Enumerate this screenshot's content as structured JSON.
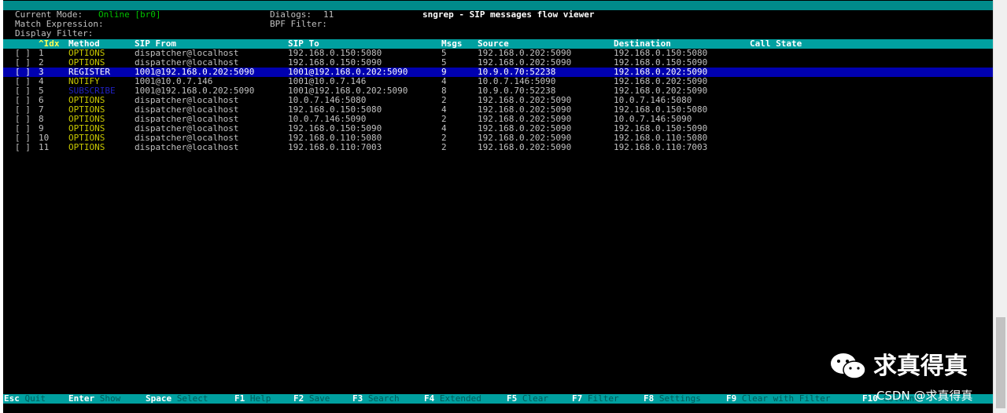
{
  "title": "sngrep - SIP messages flow viewer",
  "info": {
    "current_mode_label": "Current Mode:",
    "current_mode_value": "Online [br0]",
    "dialogs_label": "Dialogs:",
    "dialogs_value": "11",
    "match_expression_label": "Match Expression:",
    "bpf_filter_label": "BPF Filter:",
    "display_filter_label": "Display Filter:"
  },
  "columns": {
    "idx": "^Idx",
    "method": "Method",
    "sip_from": "SIP From",
    "sip_to": "SIP To",
    "msgs": "Msgs",
    "source": "Source",
    "destination": "Destination",
    "call_state": "Call State"
  },
  "rows": [
    {
      "check": "[ ]",
      "idx": "1",
      "method": "OPTIONS",
      "from": "dispatcher@localhost",
      "to": "192.168.0.150:5080",
      "msgs": "5",
      "source": "192.168.0.202:5090",
      "destination": "192.168.0.150:5080",
      "state": ""
    },
    {
      "check": "[ ]",
      "idx": "2",
      "method": "OPTIONS",
      "from": "dispatcher@localhost",
      "to": "192.168.0.150:5090",
      "msgs": "5",
      "source": "192.168.0.202:5090",
      "destination": "192.168.0.150:5090",
      "state": ""
    },
    {
      "check": "[ ]",
      "idx": "3",
      "method": "REGISTER",
      "from": "1001@192.168.0.202:5090",
      "to": "1001@192.168.0.202:5090",
      "msgs": "9",
      "source": "10.9.0.70:52238",
      "destination": "192.168.0.202:5090",
      "state": ""
    },
    {
      "check": "[ ]",
      "idx": "4",
      "method": "NOTIFY",
      "from": "1001@10.0.7.146",
      "to": "1001@10.0.7.146",
      "msgs": "4",
      "source": "10.0.7.146:5090",
      "destination": "192.168.0.202:5090",
      "state": ""
    },
    {
      "check": "[ ]",
      "idx": "5",
      "method": "SUBSCRIBE",
      "from": "1001@192.168.0.202:5090",
      "to": "1001@192.168.0.202:5090",
      "msgs": "8",
      "source": "10.9.0.70:52238",
      "destination": "192.168.0.202:5090",
      "state": ""
    },
    {
      "check": "[ ]",
      "idx": "6",
      "method": "OPTIONS",
      "from": "dispatcher@localhost",
      "to": "10.0.7.146:5080",
      "msgs": "2",
      "source": "192.168.0.202:5090",
      "destination": "10.0.7.146:5080",
      "state": ""
    },
    {
      "check": "[ ]",
      "idx": "7",
      "method": "OPTIONS",
      "from": "dispatcher@localhost",
      "to": "192.168.0.150:5080",
      "msgs": "4",
      "source": "192.168.0.202:5090",
      "destination": "192.168.0.150:5080",
      "state": ""
    },
    {
      "check": "[ ]",
      "idx": "8",
      "method": "OPTIONS",
      "from": "dispatcher@localhost",
      "to": "10.0.7.146:5090",
      "msgs": "2",
      "source": "192.168.0.202:5090",
      "destination": "10.0.7.146:5090",
      "state": ""
    },
    {
      "check": "[ ]",
      "idx": "9",
      "method": "OPTIONS",
      "from": "dispatcher@localhost",
      "to": "192.168.0.150:5090",
      "msgs": "4",
      "source": "192.168.0.202:5090",
      "destination": "192.168.0.150:5090",
      "state": ""
    },
    {
      "check": "[ ]",
      "idx": "10",
      "method": "OPTIONS",
      "from": "dispatcher@localhost",
      "to": "192.168.0.110:5080",
      "msgs": "2",
      "source": "192.168.0.202:5090",
      "destination": "192.168.0.110:5080",
      "state": ""
    },
    {
      "check": "[ ]",
      "idx": "11",
      "method": "OPTIONS",
      "from": "dispatcher@localhost",
      "to": "192.168.0.110:7003",
      "msgs": "2",
      "source": "192.168.0.202:5090",
      "destination": "192.168.0.110:7003",
      "state": ""
    }
  ],
  "footer": [
    {
      "key": "Esc",
      "action": "Quit"
    },
    {
      "key": "Enter",
      "action": "Show"
    },
    {
      "key": "Space",
      "action": "Select"
    },
    {
      "key": "F1",
      "action": "Help"
    },
    {
      "key": "F2",
      "action": "Save"
    },
    {
      "key": "F3",
      "action": "Search"
    },
    {
      "key": "F4",
      "action": "Extended"
    },
    {
      "key": "F5",
      "action": "Clear"
    },
    {
      "key": "F7",
      "action": "Filter"
    },
    {
      "key": "F8",
      "action": "Settings"
    },
    {
      "key": "F9",
      "action": "Clear with Filter"
    },
    {
      "key": "F10",
      "action": "Columns"
    }
  ],
  "watermark": {
    "icon": "wechat-icon",
    "text": "求真得真",
    "csdn": "CSDN @求真得真"
  },
  "colors": {
    "title_bg": "#008b8b",
    "header_bg": "#00a0a0",
    "selected_bg": "#0000b0",
    "method_yellow": "#c8c800",
    "mode_green": "#00c000"
  }
}
